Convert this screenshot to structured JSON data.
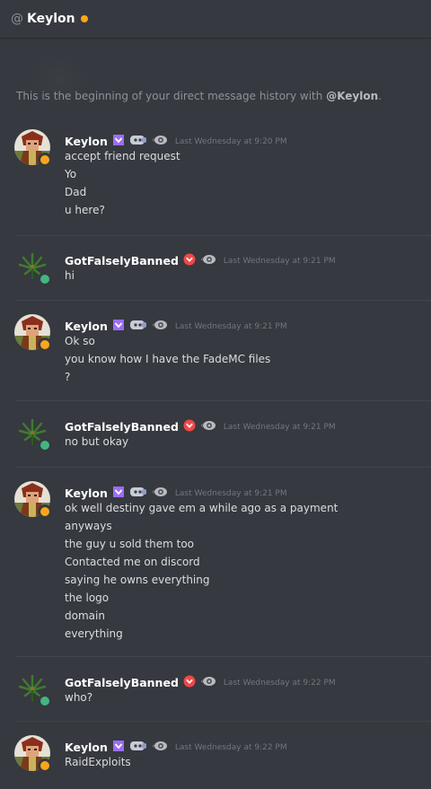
{
  "header": {
    "at_symbol": "@",
    "title": "Keylon",
    "status_color": "#faa61a"
  },
  "intro": {
    "prefix": "This is the beginning of your direct message history with ",
    "mention": "@Keylon",
    "suffix": "."
  },
  "colors": {
    "background": "#36393f",
    "online": "#43b581",
    "idle": "#faa61a",
    "nitro_badge": "#9b6df3",
    "red_badge": "#f04747"
  },
  "messages": [
    {
      "author": "Keylon",
      "timestamp": "Last Wednesday at 9:20 PM",
      "presence": "idle",
      "badges": [
        "nitro-badge",
        "discord-badge",
        "eye-badge"
      ],
      "lines": [
        "accept friend request",
        "Yo",
        "Dad",
        "u here?"
      ]
    },
    {
      "author": "GotFalselyBanned",
      "timestamp": "Last Wednesday at 9:21 PM",
      "presence": "online",
      "badges": [
        "red-chevron-badge",
        "eye-badge"
      ],
      "lines": [
        "hi"
      ]
    },
    {
      "author": "Keylon",
      "timestamp": "Last Wednesday at 9:21 PM",
      "presence": "idle",
      "badges": [
        "nitro-badge",
        "discord-badge",
        "eye-badge"
      ],
      "lines": [
        "Ok so",
        "you know how I have the FadeMC files",
        "?"
      ]
    },
    {
      "author": "GotFalselyBanned",
      "timestamp": "Last Wednesday at 9:21 PM",
      "presence": "online",
      "badges": [
        "red-chevron-badge",
        "eye-badge"
      ],
      "lines": [
        "no but okay"
      ]
    },
    {
      "author": "Keylon",
      "timestamp": "Last Wednesday at 9:21 PM",
      "presence": "idle",
      "badges": [
        "nitro-badge",
        "discord-badge",
        "eye-badge"
      ],
      "lines": [
        "ok well destiny gave em a while ago as a payment",
        "anyways",
        "the guy u sold them too",
        "Contacted me on discord",
        "saying he owns everything",
        "the logo",
        "domain",
        "everything"
      ]
    },
    {
      "author": "GotFalselyBanned",
      "timestamp": "Last Wednesday at 9:22 PM",
      "presence": "online",
      "badges": [
        "red-chevron-badge",
        "eye-badge"
      ],
      "lines": [
        "who?"
      ]
    },
    {
      "author": "Keylon",
      "timestamp": "Last Wednesday at 9:22 PM",
      "presence": "idle",
      "badges": [
        "nitro-badge",
        "discord-badge",
        "eye-badge"
      ],
      "lines": [
        "RaidExploits"
      ]
    }
  ]
}
